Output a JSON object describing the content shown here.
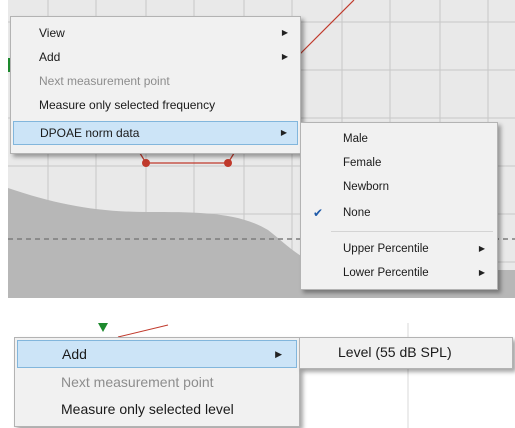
{
  "top_menu": {
    "items": [
      {
        "label": "View",
        "submenu": true,
        "enabled": true
      },
      {
        "label": "Add",
        "submenu": true,
        "enabled": true
      },
      {
        "label": "Next measurement point",
        "submenu": false,
        "enabled": false
      },
      {
        "label": "Measure only selected frequency",
        "submenu": false,
        "enabled": true
      },
      {
        "label": "DPOAE norm data",
        "submenu": true,
        "enabled": true,
        "highlighted": true
      }
    ]
  },
  "norm_submenu": {
    "items": [
      {
        "label": "Male",
        "checked": false
      },
      {
        "label": "Female",
        "checked": false
      },
      {
        "label": "Newborn",
        "checked": false
      },
      {
        "label": "None",
        "checked": true
      },
      {
        "label": "Upper Percentile",
        "submenu": true
      },
      {
        "label": "Lower Percentile",
        "submenu": true
      }
    ]
  },
  "bottom_menu": {
    "items": [
      {
        "label": "Add",
        "submenu": true,
        "enabled": true,
        "highlighted": true
      },
      {
        "label": "Next measurement point",
        "submenu": false,
        "enabled": false
      },
      {
        "label": "Measure only selected  level",
        "submenu": false,
        "enabled": true
      }
    ]
  },
  "level_submenu": {
    "items": [
      {
        "label": "Level (55 dB SPL)"
      }
    ]
  },
  "colors": {
    "accent_highlight": "#cce4f7",
    "curve_red": "#c0392b",
    "marker_green": "#1e8a2e"
  }
}
